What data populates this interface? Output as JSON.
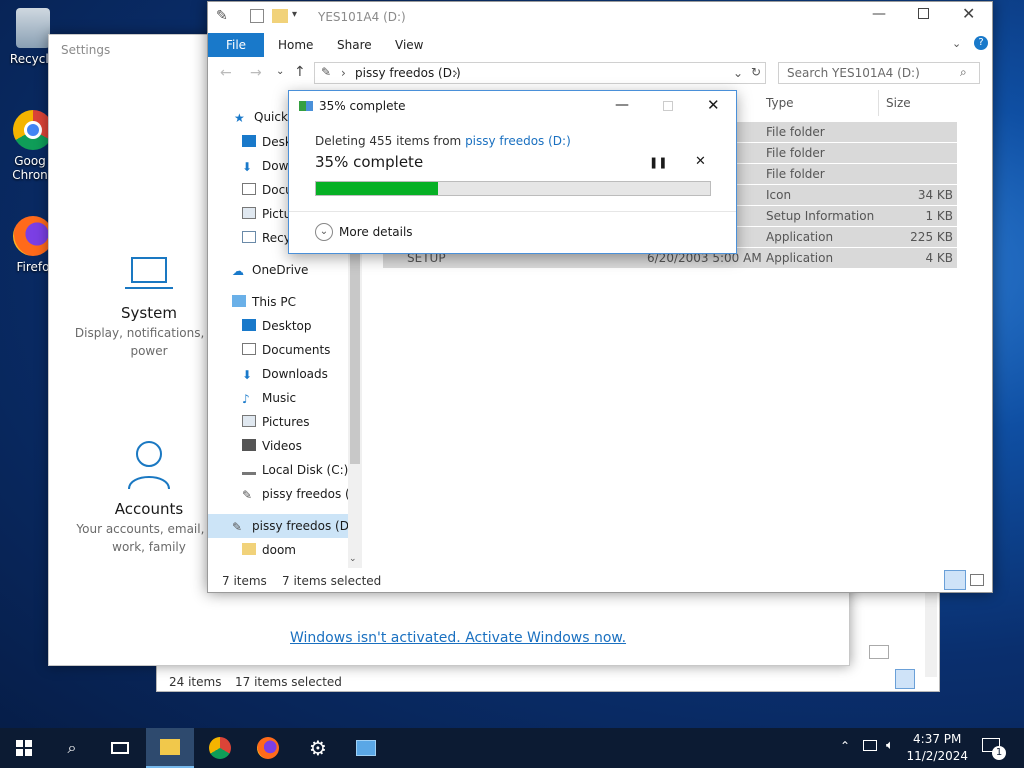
{
  "desktop": {
    "icons": [
      {
        "label": "Recycle"
      },
      {
        "label": "Goog Chron"
      },
      {
        "label": "Firefo"
      }
    ]
  },
  "settings": {
    "title": "Settings",
    "cards": [
      {
        "name": "System",
        "desc": "Display, notifications, ap power"
      },
      {
        "name": "Accounts",
        "desc": "Your accounts, email, sy work, family"
      }
    ],
    "activate_text": "Windows isn't activated. Activate Windows now."
  },
  "back_explorer": {
    "status_items": "24 items",
    "status_selected": "17 items selected"
  },
  "explorer": {
    "title": "YES101A4 (D:)",
    "ribbon": {
      "file": "File",
      "tabs": [
        "Home",
        "Share",
        "View"
      ]
    },
    "address": "pissy freedos (D:)",
    "search_placeholder": "Search YES101A4 (D:)",
    "nav": {
      "quick_access": "Quick",
      "quick_items": [
        "Deskt",
        "Down",
        "Docu",
        "Pictu",
        "Recyc"
      ],
      "onedrive": "OneDrive",
      "this_pc": "This PC",
      "pc_items": [
        "Desktop",
        "Documents",
        "Downloads",
        "Music",
        "Pictures",
        "Videos",
        "Local Disk (C:)",
        "pissy freedos (D:"
      ],
      "drive": "pissy freedos (D:)",
      "doom": "doom"
    },
    "columns": {
      "type": "Type",
      "size": "Size"
    },
    "rows": [
      {
        "name": "",
        "date": "M",
        "type": "File folder",
        "size": ""
      },
      {
        "name": "",
        "date": "M",
        "type": "File folder",
        "size": ""
      },
      {
        "name": "",
        "date": "M",
        "type": "File folder",
        "size": ""
      },
      {
        "name": "",
        "date": "M",
        "type": "Icon",
        "size": "34 KB"
      },
      {
        "name": "",
        "date": "M",
        "type": "Setup Information",
        "size": "1 KB"
      },
      {
        "name": "",
        "date": "M",
        "type": "Application",
        "size": "225 KB"
      },
      {
        "name": "SETUP",
        "date": "6/20/2003 5:00 AM",
        "type": "Application",
        "size": "4 KB"
      }
    ],
    "status_items": "7 items",
    "status_selected": "7 items selected"
  },
  "dialog": {
    "title": "35% complete",
    "line1_prefix": "Deleting 455 items from ",
    "line1_link": "pissy freedos (D:)",
    "big": "35% complete",
    "progress": 0.31,
    "more_details": "More details"
  },
  "taskbar": {
    "time": "4:37 PM",
    "date": "11/2/2024",
    "notification_count": "1"
  }
}
